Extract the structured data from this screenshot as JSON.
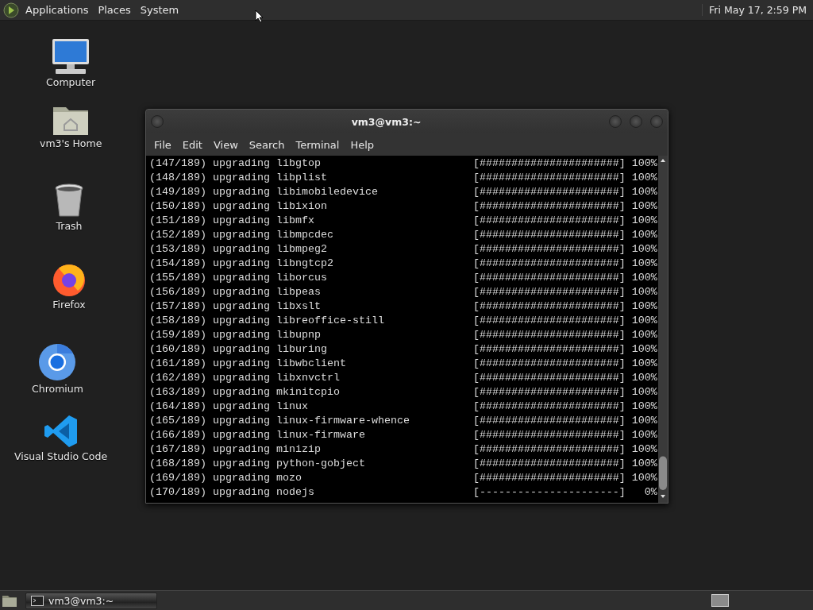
{
  "top_panel": {
    "menus": [
      "Applications",
      "Places",
      "System"
    ],
    "clock": "Fri May 17, 2:59 PM"
  },
  "desktop_icons": [
    {
      "label": "Computer",
      "kind": "computer"
    },
    {
      "label": "vm3's Home",
      "kind": "home"
    },
    {
      "label": "Trash",
      "kind": "trash"
    },
    {
      "label": "Firefox",
      "kind": "firefox"
    },
    {
      "label": "Chromium",
      "kind": "chromium"
    },
    {
      "label": "Visual Studio Code",
      "kind": "vscode"
    }
  ],
  "terminal": {
    "title": "vm3@vm3:~",
    "menu": [
      "File",
      "Edit",
      "View",
      "Search",
      "Terminal",
      "Help"
    ],
    "lines": [
      {
        "text": "(147/189) upgrading libgtop",
        "bar": "[######################]",
        "percent": "100%"
      },
      {
        "text": "(148/189) upgrading libplist",
        "bar": "[######################]",
        "percent": "100%"
      },
      {
        "text": "(149/189) upgrading libimobiledevice",
        "bar": "[######################]",
        "percent": "100%"
      },
      {
        "text": "(150/189) upgrading libixion",
        "bar": "[######################]",
        "percent": "100%"
      },
      {
        "text": "(151/189) upgrading libmfx",
        "bar": "[######################]",
        "percent": "100%"
      },
      {
        "text": "(152/189) upgrading libmpcdec",
        "bar": "[######################]",
        "percent": "100%"
      },
      {
        "text": "(153/189) upgrading libmpeg2",
        "bar": "[######################]",
        "percent": "100%"
      },
      {
        "text": "(154/189) upgrading libngtcp2",
        "bar": "[######################]",
        "percent": "100%"
      },
      {
        "text": "(155/189) upgrading liborcus",
        "bar": "[######################]",
        "percent": "100%"
      },
      {
        "text": "(156/189) upgrading libpeas",
        "bar": "[######################]",
        "percent": "100%"
      },
      {
        "text": "(157/189) upgrading libxslt",
        "bar": "[######################]",
        "percent": "100%"
      },
      {
        "text": "(158/189) upgrading libreoffice-still",
        "bar": "[######################]",
        "percent": "100%"
      },
      {
        "text": "(159/189) upgrading libupnp",
        "bar": "[######################]",
        "percent": "100%"
      },
      {
        "text": "(160/189) upgrading liburing",
        "bar": "[######################]",
        "percent": "100%"
      },
      {
        "text": "(161/189) upgrading libwbclient",
        "bar": "[######################]",
        "percent": "100%"
      },
      {
        "text": "(162/189) upgrading libxnvctrl",
        "bar": "[######################]",
        "percent": "100%"
      },
      {
        "text": "(163/189) upgrading mkinitcpio",
        "bar": "[######################]",
        "percent": "100%"
      },
      {
        "text": "(164/189) upgrading linux",
        "bar": "[######################]",
        "percent": "100%"
      },
      {
        "text": "(165/189) upgrading linux-firmware-whence",
        "bar": "[######################]",
        "percent": "100%"
      },
      {
        "text": "(166/189) upgrading linux-firmware",
        "bar": "[######################]",
        "percent": "100%"
      },
      {
        "text": "(167/189) upgrading minizip",
        "bar": "[######################]",
        "percent": "100%"
      },
      {
        "text": "(168/189) upgrading python-gobject",
        "bar": "[######################]",
        "percent": "100%"
      },
      {
        "text": "(169/189) upgrading mozo",
        "bar": "[######################]",
        "percent": "100%"
      },
      {
        "text": "(170/189) upgrading nodejs",
        "bar": "[----------------------]",
        "percent": "0%"
      }
    ]
  },
  "taskbar": {
    "tasks": [
      {
        "label": "vm3@vm3:~",
        "selected": true
      }
    ]
  }
}
